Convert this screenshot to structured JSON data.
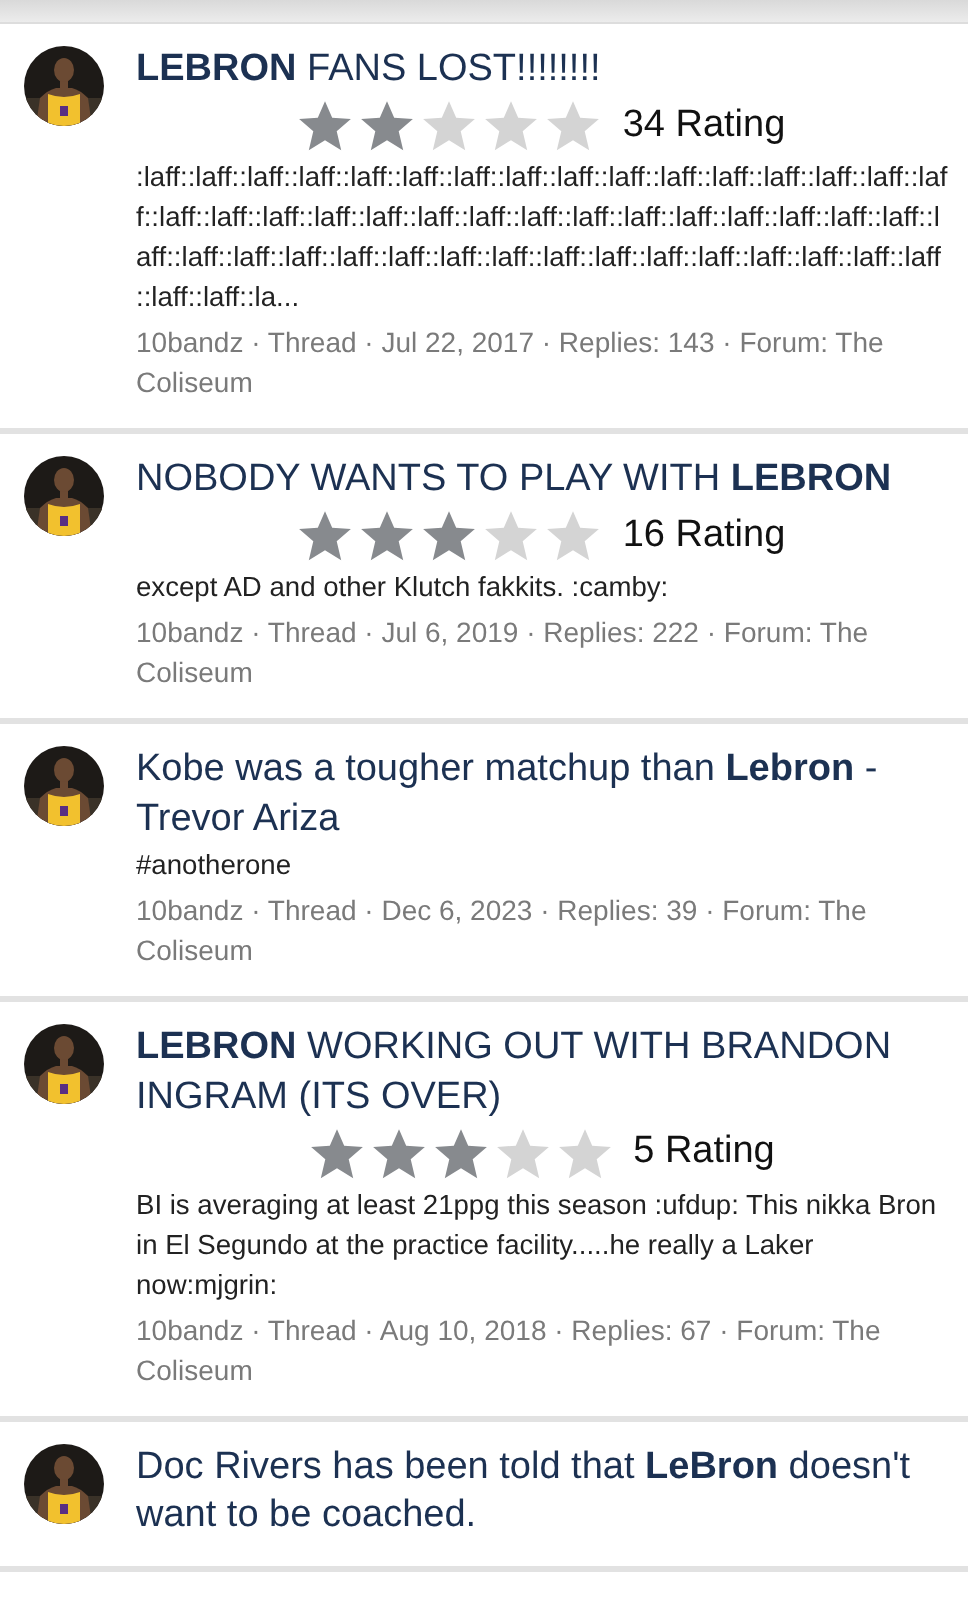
{
  "threads": [
    {
      "title": "**LEBRON** FANS LOST!!!!!!!!",
      "stars": 2,
      "rating": "34 Rating",
      "snippet": ":laff::laff::laff::laff::laff::laff::laff::laff::laff::laff::laff::laff::laff::laff::laff::laff::laff::laff::laff::laff::laff::laff::laff::laff::laff::laff::laff::laff::laff::laff::laff::laff::laff::laff::laff::laff::laff::laff::laff::laff::laff::laff::laff::laff::laff::laff::laff::laff::laff::la...",
      "meta": "10bandz · Thread · Jul 22, 2017 · Replies: 143 · Forum: The Coliseum"
    },
    {
      "title": "NOBODY WANTS TO PLAY WITH **LEBRON**",
      "stars": 3,
      "rating": "16 Rating",
      "snippet": "except AD and other Klutch fakkits. :camby:",
      "meta": "10bandz · Thread · Jul 6, 2019 · Replies: 222 · Forum: The Coliseum"
    },
    {
      "title": "Kobe was a tougher matchup than **Lebron** - Trevor Ariza",
      "snippet": "#anotherone",
      "meta": "10bandz · Thread · Dec 6, 2023 · Replies: 39 · Forum: The Coliseum"
    },
    {
      "title": "**LEBRON** WORKING OUT WITH BRANDON INGRAM (ITS OVER)",
      "stars": 3,
      "rating": "5 Rating",
      "snippet": "BI is averaging at least 21ppg this season :ufdup: This nikka Bron in El Segundo at the practice facility.....he really a Laker now:mjgrin:",
      "meta": "10bandz · Thread · Aug 10, 2018 · Replies: 67 · Forum: The Coliseum"
    },
    {
      "title": "Doc Rivers has been told that **LeBron** doesn't want to be coached."
    }
  ]
}
